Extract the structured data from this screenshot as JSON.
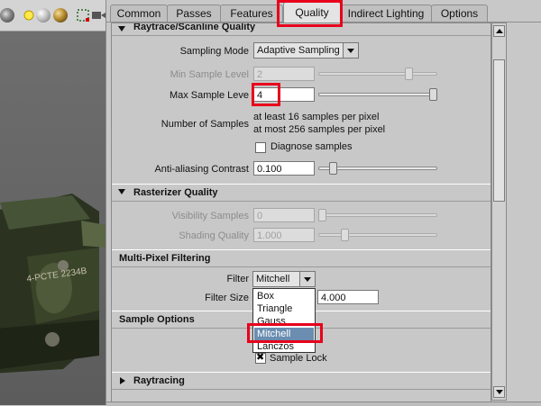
{
  "tabs": [
    {
      "label": "Common"
    },
    {
      "label": "Passes"
    },
    {
      "label": "Features"
    },
    {
      "label": "Quality"
    },
    {
      "label": "Indirect Lighting"
    },
    {
      "label": "Options"
    }
  ],
  "active_tab": "Quality",
  "sections": {
    "raytrace_scanline": {
      "title": "Raytrace/Scanline Quality",
      "sampling_mode": {
        "label": "Sampling Mode",
        "value": "Adaptive Sampling"
      },
      "min_sample_level": {
        "label": "Min Sample Level",
        "value": "2",
        "slider_fraction": 0.78
      },
      "max_sample_level": {
        "label": "Max Sample Leve",
        "value": "4",
        "slider_fraction": 1.0
      },
      "number_of_samples": {
        "label": "Number of Samples",
        "line1": "at least 16 samples per pixel",
        "line2": "at most 256 samples per pixel"
      },
      "diagnose_samples": {
        "label": "Diagnose samples",
        "checked": false
      },
      "anti_aliasing_contrast": {
        "label": "Anti-aliasing Contrast",
        "value": "0.100",
        "slider_fraction": 0.1
      }
    },
    "rasterizer_quality": {
      "title": "Rasterizer Quality",
      "visibility_samples": {
        "label": "Visibility Samples",
        "value": "0",
        "slider_fraction": 0.0
      },
      "shading_quality": {
        "label": "Shading Quality",
        "value": "1.000",
        "slider_fraction": 0.2
      }
    },
    "multi_pixel_filtering": {
      "title": "Multi-Pixel Filtering",
      "filter": {
        "label": "Filter",
        "value": "Mitchell",
        "options": [
          "Box",
          "Triangle",
          "Gauss",
          "Mitchell",
          "Lanczos"
        ],
        "selected": "Mitchell"
      },
      "filter_size": {
        "label": "Filter Size",
        "value": "4.000"
      }
    },
    "sample_options": {
      "title": "Sample Options",
      "sample_lock": {
        "label": "Sample Lock",
        "checked": true
      }
    },
    "raytracing": {
      "title": "Raytracing"
    }
  },
  "viewport": {
    "tank_markings": "4-PCTE 2234B"
  },
  "colors": {
    "annotation": "#e8001c",
    "list_highlight": "#6a8db0"
  },
  "icons": [
    "wireframe-shaded-icon",
    "light-icon",
    "texture-icon",
    "shaded-sphere-icon",
    "frame-icon",
    "camera-icon"
  ]
}
